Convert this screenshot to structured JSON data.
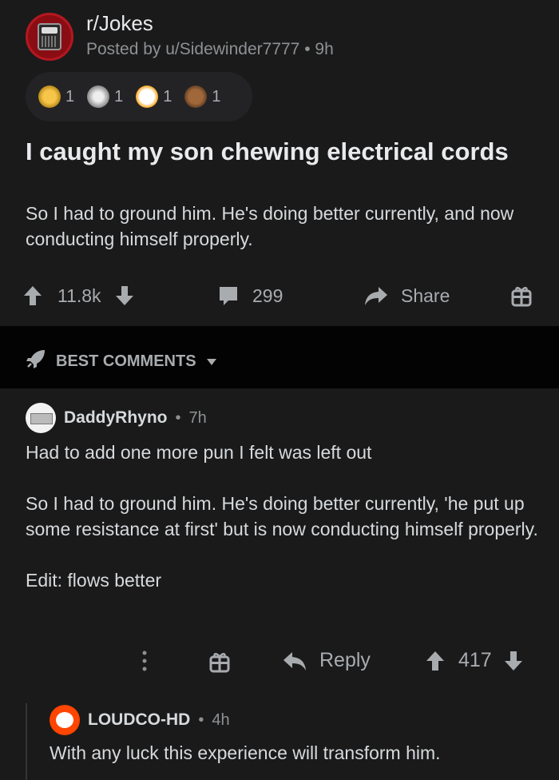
{
  "post": {
    "subreddit": "r/Jokes",
    "posted_by": "Posted by u/Sidewinder7777",
    "age": "9h",
    "awards": [
      {
        "icon": "gold-award-icon",
        "count": "1"
      },
      {
        "icon": "clap-award-icon",
        "count": "1"
      },
      {
        "icon": "wholesome-face-award-icon",
        "count": "1"
      },
      {
        "icon": "bear-award-icon",
        "count": "1"
      }
    ],
    "title": "I caught my son chewing electrical cords",
    "body": "So I had to ground him. He's doing better currently, and now conducting himself properly.",
    "score": "11.8k",
    "comments": "299",
    "share_label": "Share"
  },
  "sort": {
    "label": "BEST COMMENTS"
  },
  "comments": [
    {
      "author": "DaddyRhyno",
      "age": "7h",
      "paragraphs": [
        "Had to add one more pun I felt was left out",
        "So I had to ground him. He's doing better currently, 'he put up some resistance at first' but is now conducting himself properly.",
        "Edit: flows better"
      ],
      "reply_label": "Reply",
      "score": "417"
    },
    {
      "author": "LOUDCO-HD",
      "age": "4h",
      "paragraphs": [
        "With any luck this experience will transform him."
      ]
    }
  ],
  "colors": {
    "background": "#1a1a1b",
    "band": "#030303",
    "text": "#d7dadc",
    "muted": "#8e9193"
  }
}
